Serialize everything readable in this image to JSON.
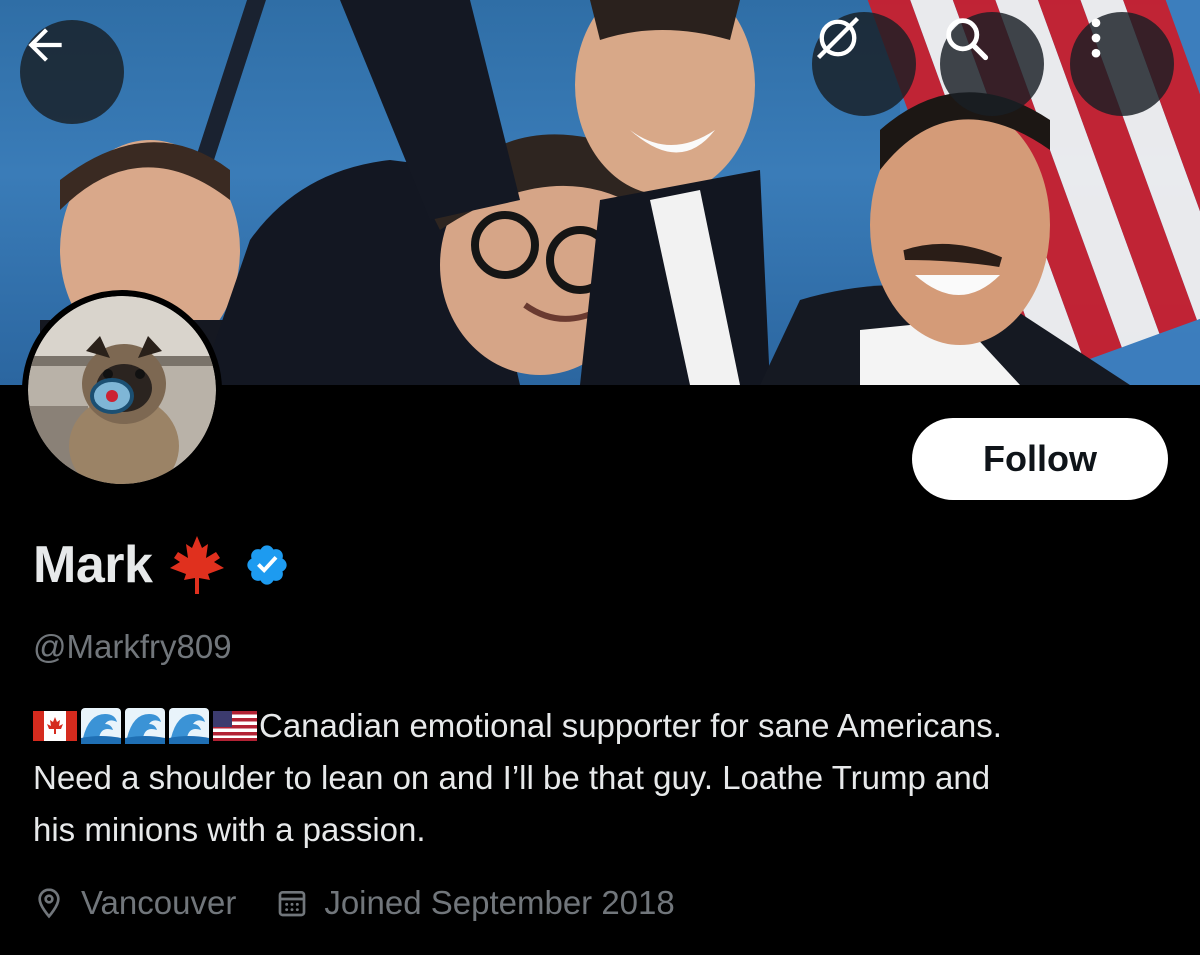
{
  "header": {
    "back_icon": "arrow-left-icon",
    "grok_icon": "grok-icon",
    "search_icon": "search-icon",
    "more_icon": "more-vertical-icon"
  },
  "profile": {
    "display_name": "Mark",
    "name_emoji": "maple-leaf",
    "verified": true,
    "handle": "@Markfry809",
    "follow_label": "Follow",
    "bio_emojis": [
      "flag-canada",
      "water-wave",
      "water-wave",
      "water-wave",
      "flag-usa"
    ],
    "bio_lines": [
      "Canadian emotional supporter for sane Americans.",
      "Need a shoulder to lean on and I’ll be that guy. Loathe Trump and",
      "his minions with a passion."
    ],
    "location": "Vancouver",
    "joined": "Joined September 2018"
  },
  "colors": {
    "background": "#000000",
    "primary_text": "#e7e9ea",
    "secondary_text": "#71767b",
    "verified_blue": "#1d9bf0",
    "follow_bg": "#ffffff",
    "follow_text": "#0f1419",
    "maple_red": "#e0301e"
  }
}
